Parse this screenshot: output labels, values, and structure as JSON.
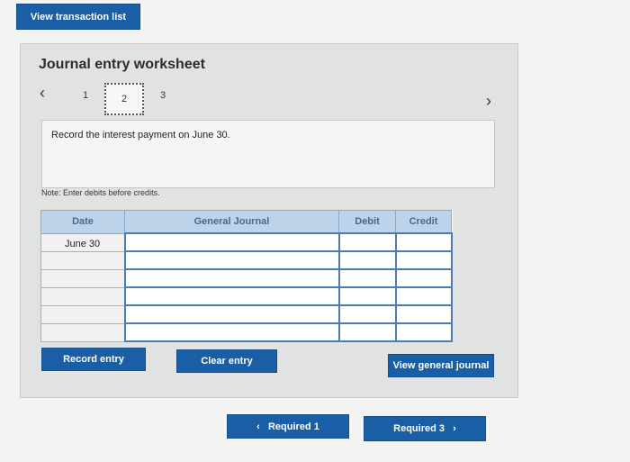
{
  "header": {
    "view_list_label": "View transaction list"
  },
  "worksheet": {
    "title": "Journal entry worksheet",
    "prev_icon": "‹",
    "next_icon": "›",
    "steps": [
      "1",
      "2",
      "3"
    ],
    "current_step": "2",
    "instruction": "Record the interest payment on June 30.",
    "note": "Note: Enter debits before credits."
  },
  "table": {
    "headers": {
      "date": "Date",
      "journal": "General Journal",
      "debit": "Debit",
      "credit": "Credit"
    },
    "rows": [
      {
        "date": "June 30",
        "account": "",
        "debit": "",
        "credit": ""
      },
      {
        "date": "",
        "account": "",
        "debit": "",
        "credit": ""
      },
      {
        "date": "",
        "account": "",
        "debit": "",
        "credit": ""
      },
      {
        "date": "",
        "account": "",
        "debit": "",
        "credit": ""
      },
      {
        "date": "",
        "account": "",
        "debit": "",
        "credit": ""
      },
      {
        "date": "",
        "account": "",
        "debit": "",
        "credit": ""
      }
    ]
  },
  "actions": {
    "record": "Record entry",
    "clear": "Clear entry",
    "view_general": "View general journal"
  },
  "footer": {
    "required1": "‹   Required 1",
    "required3": "Required 3   ›"
  }
}
